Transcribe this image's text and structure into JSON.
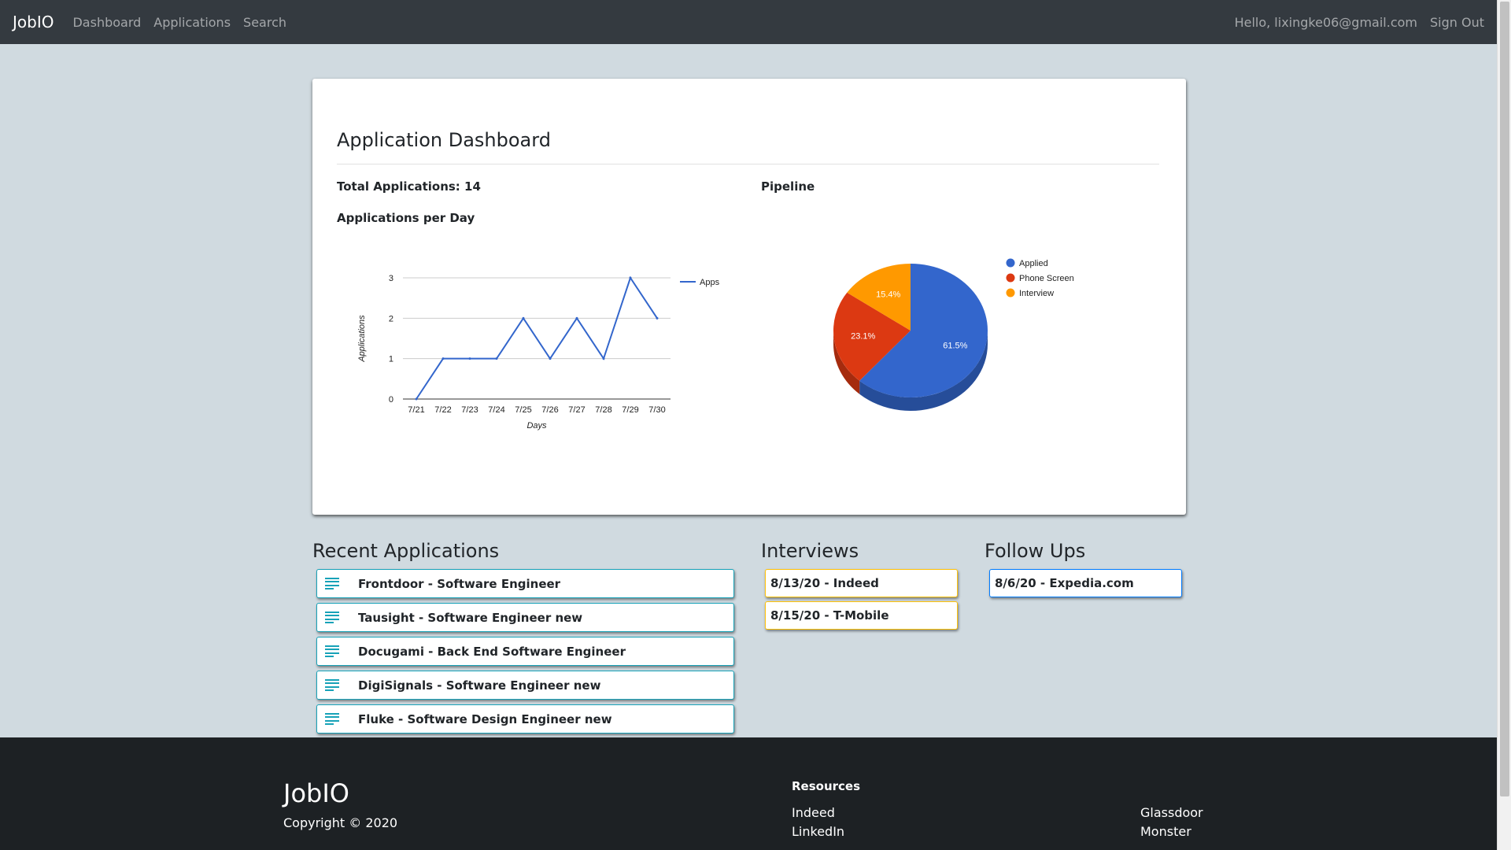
{
  "navbar": {
    "brand": "JobIO",
    "links": [
      "Dashboard",
      "Applications",
      "Search"
    ],
    "greeting": "Hello, lixingke06@gmail.com",
    "sign_out": "Sign Out"
  },
  "dashboard": {
    "title": "Application Dashboard",
    "total_label": "Total Applications: 14",
    "per_day_label": "Applications per Day",
    "pipeline_label": "Pipeline"
  },
  "chart_data": [
    {
      "type": "line",
      "title": "",
      "xlabel": "Days",
      "ylabel": "Applications",
      "x": [
        "7/21",
        "7/22",
        "7/23",
        "7/24",
        "7/25",
        "7/26",
        "7/27",
        "7/28",
        "7/29",
        "7/30"
      ],
      "series": [
        {
          "name": "Apps",
          "values": [
            0,
            1,
            1,
            1,
            2,
            1,
            2,
            1,
            3,
            2
          ],
          "color": "#3366cc"
        }
      ],
      "y_ticks": [
        0,
        1,
        2,
        3
      ],
      "ylim": [
        0,
        3
      ],
      "grid": true,
      "legend": "right"
    },
    {
      "type": "pie",
      "style": "3d",
      "labels": [
        "Applied",
        "Phone Screen",
        "Interview"
      ],
      "values": [
        61.5,
        23.1,
        15.4
      ],
      "value_labels": [
        "61.5%",
        "23.1%",
        "15.4%"
      ],
      "colors": [
        "#3366cc",
        "#dc3912",
        "#ff9900"
      ],
      "legend": "top-right"
    }
  ],
  "recent_applications": {
    "title": "Recent Applications",
    "items": [
      "Frontdoor - Software Engineer",
      "Tausight - Software Engineer new",
      "Docugami - Back End Software Engineer",
      "DigiSignals - Software Engineer new",
      "Fluke - Software Design Engineer new"
    ]
  },
  "interviews": {
    "title": "Interviews",
    "items": [
      "8/13/20 - Indeed",
      "8/15/20 - T-Mobile"
    ]
  },
  "follow_ups": {
    "title": "Follow Ups",
    "items": [
      "8/6/20 - Expedia.com"
    ]
  },
  "footer": {
    "brand": "JobIO",
    "copyright": "Copyright © 2020",
    "resources_heading": "Resources",
    "links_col1": [
      "Indeed",
      "LinkedIn"
    ],
    "links_col2": [
      "Glassdoor",
      "Monster"
    ]
  },
  "colors": {
    "teal": "#17a2b8",
    "yellow": "#ffc107",
    "blue": "#007bff",
    "navbar": "#343a40",
    "footer": "#1d2124",
    "background": "#d0dae0"
  }
}
